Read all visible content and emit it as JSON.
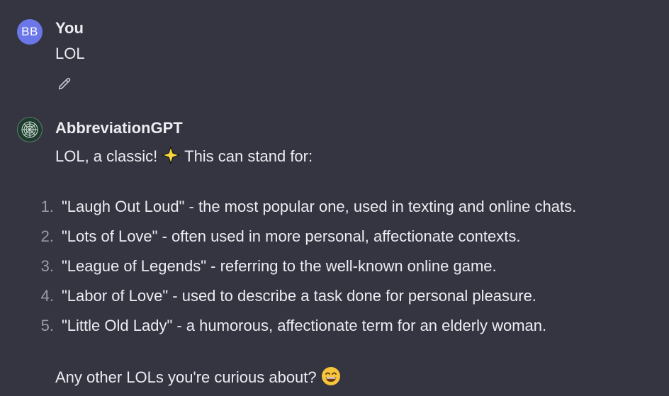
{
  "user_message": {
    "avatar_initials": "BB",
    "author": "You",
    "text": "LOL",
    "edit_icon": "pencil-icon"
  },
  "bot_message": {
    "avatar_icon": "gpt-logo-icon",
    "author": "AbbreviationGPT",
    "intro_before": "LOL, a classic!",
    "intro_emoji_icon": "sparkle-star-icon",
    "intro_after": "This can stand for:",
    "list": [
      {
        "num": "1.",
        "text": "\"Laugh Out Loud\" - the most popular one, used in texting and online chats."
      },
      {
        "num": "2.",
        "text": "\"Lots of Love\" - often used in more personal, affectionate contexts."
      },
      {
        "num": "3.",
        "text": "\"League of Legends\" - referring to the well-known online game."
      },
      {
        "num": "4.",
        "text": "\"Labor of Love\" - used to describe a task done for personal pleasure."
      },
      {
        "num": "5.",
        "text": "\"Little Old Lady\" - a humorous, affectionate term for an elderly woman."
      }
    ],
    "closing": "Any other LOLs you're curious about?",
    "closing_emoji_icon": "grinning-face-icon"
  },
  "colors": {
    "background": "#343541",
    "text": "#ececf1",
    "muted": "#9b9ba6",
    "user_avatar": "#6b77e8"
  }
}
